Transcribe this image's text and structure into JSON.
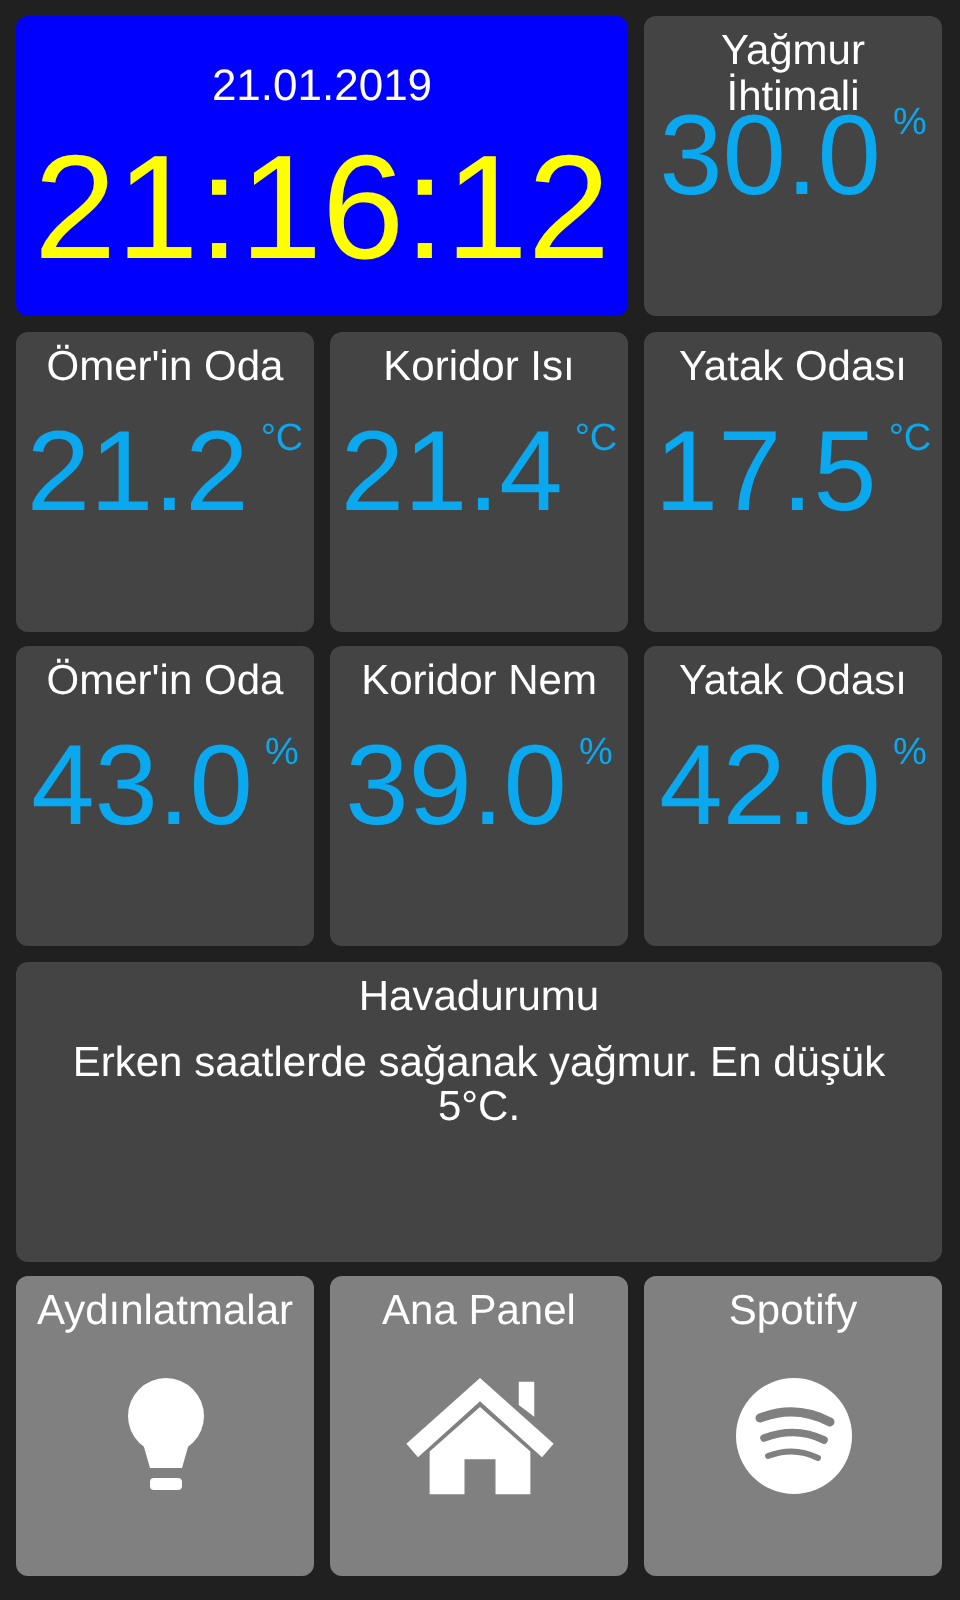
{
  "clock": {
    "date": "21.01.2019",
    "time": "21:16:12"
  },
  "sensors": [
    {
      "name": "Yağmur İhtimali",
      "value": "30.0",
      "unit": "%"
    },
    {
      "name": "Ömer'in Oda",
      "value": "21.2",
      "unit": "°C"
    },
    {
      "name": "Koridor Isı",
      "value": "21.4",
      "unit": "°C"
    },
    {
      "name": "Yatak Odası",
      "value": "17.5",
      "unit": "°C"
    },
    {
      "name": "Ömer'in Oda",
      "value": "43.0",
      "unit": "%"
    },
    {
      "name": "Koridor Nem",
      "value": "39.0",
      "unit": "%"
    },
    {
      "name": "Yatak Odası",
      "value": "42.0",
      "unit": "%"
    }
  ],
  "weather": {
    "title": "Havadurumu",
    "text": "Erken saatlerde sağanak yağmur. En düşük 5°C."
  },
  "buttons": [
    {
      "label": "Aydınlatmalar"
    },
    {
      "label": "Ana Panel"
    },
    {
      "label": "Spotify"
    }
  ]
}
